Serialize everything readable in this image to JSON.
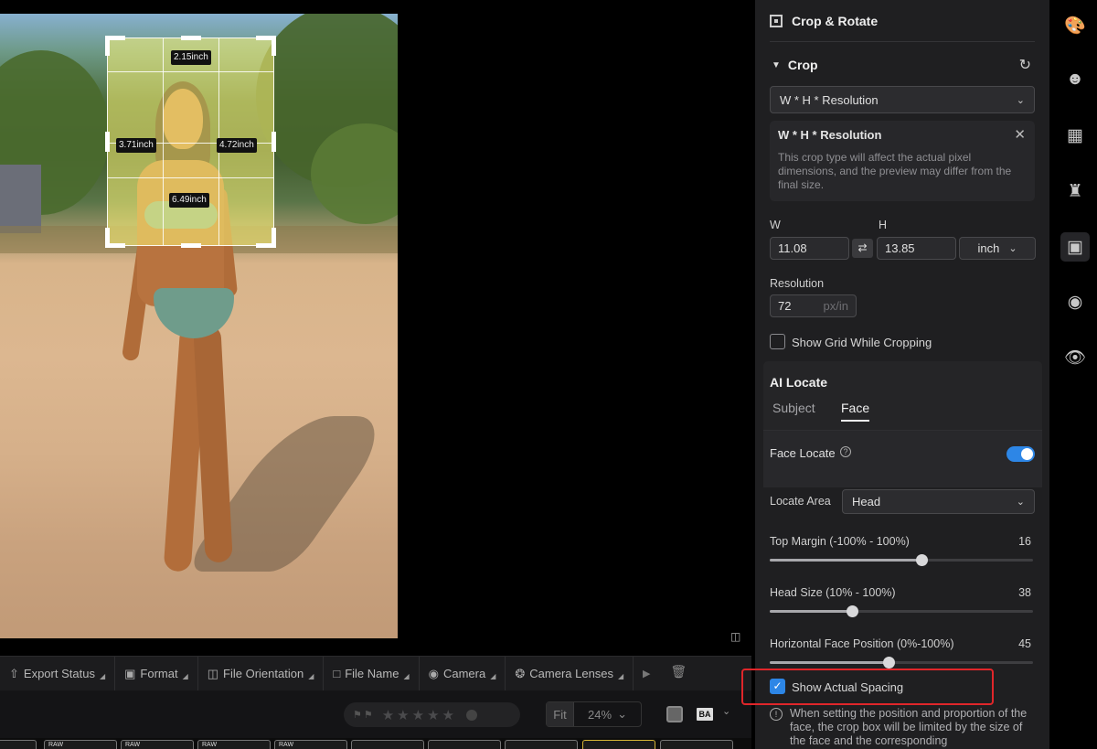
{
  "canvas": {
    "crop_dims": {
      "top": "2.15inch",
      "left": "3.71inch",
      "right": "4.72inch",
      "bottom": "6.49inch"
    }
  },
  "filter_bar": {
    "items": [
      {
        "label": "Export Status",
        "icon": "export-icon"
      },
      {
        "label": "Format",
        "icon": "image-icon"
      },
      {
        "label": "File Orientation",
        "icon": "orientation-icon"
      },
      {
        "label": "File Name",
        "icon": "folder-icon"
      },
      {
        "label": "Camera",
        "icon": "camera-icon"
      },
      {
        "label": "Camera Lenses",
        "icon": "lens-icon"
      }
    ]
  },
  "toolbar": {
    "zoom_fit": "Fit",
    "zoom_pct": "24%",
    "ba_label": "BA"
  },
  "filmstrip": {
    "thumb_label": "RAW"
  },
  "panel": {
    "title": "Crop & Rotate",
    "crop_section": "Crop",
    "crop_type": "W * H * Resolution",
    "info": {
      "title": "W * H * Resolution",
      "body": "This crop type will affect the actual pixel dimensions, and the preview may differ from the final size."
    },
    "w_label": "W",
    "h_label": "H",
    "w_value": "11.08",
    "h_value": "13.85",
    "unit": "inch",
    "resolution_label": "Resolution",
    "resolution_value": "72",
    "resolution_unit": "px/in",
    "show_grid_label": "Show Grid While Cropping",
    "show_grid_checked": false,
    "ai_locate": {
      "title": "AI Locate",
      "tabs": [
        "Subject",
        "Face"
      ],
      "active_tab": "Face",
      "face_locate_label": "Face Locate",
      "face_locate_on": true
    },
    "locate_area_label": "Locate Area",
    "locate_area_value": "Head",
    "sliders": [
      {
        "label": "Top Margin (-100% - 100%)",
        "value": "16",
        "fraction": 0.575
      },
      {
        "label": "Head Size (10% - 100%)",
        "value": "38",
        "fraction": 0.311
      },
      {
        "label": "Horizontal Face Position (0%-100%)",
        "value": "45",
        "fraction": 0.45
      }
    ],
    "show_spacing_label": "Show Actual Spacing",
    "show_spacing_checked": true,
    "note": "When setting the position and proportion of the face, the crop box will be limited by the size of the face and the corresponding"
  },
  "accent_color": "#2d86e6",
  "highlight_color": "#e0262a"
}
